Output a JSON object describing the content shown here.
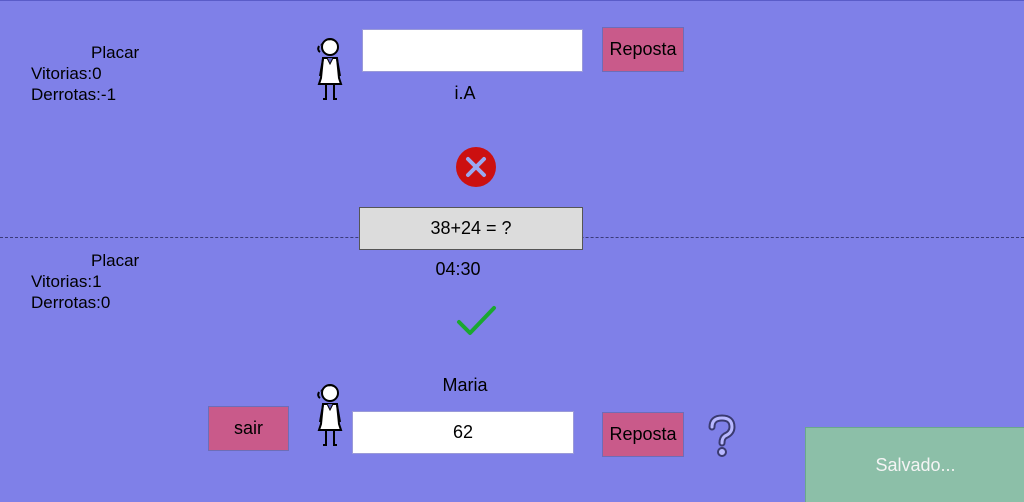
{
  "opponent": {
    "score_title": "Placar",
    "wins": "Vitorias:0",
    "losses": "Derrotas:-1",
    "name": "i.A",
    "answer_value": "",
    "answer_button": "Reposta",
    "result_icon": "wrong-cross-icon",
    "avatar_icon": "woman-avatar-icon"
  },
  "player": {
    "score_title": "Placar",
    "wins": "Vitorias:1",
    "losses": "Derrotas:0",
    "name": "Maria",
    "answer_value": "62",
    "answer_button": "Reposta",
    "result_icon": "correct-check-icon",
    "avatar_icon": "woman-avatar-icon"
  },
  "question": "38+24 = ?",
  "timer": "04:30",
  "exit_button": "sair",
  "help_icon": "question-mark-icon",
  "status": "Salvado...",
  "colors": {
    "background": "#7f80e8",
    "button": "#c95a8a",
    "wrong": "#cc1010",
    "correct": "#1aa830",
    "saved": "#8cbfa8"
  }
}
